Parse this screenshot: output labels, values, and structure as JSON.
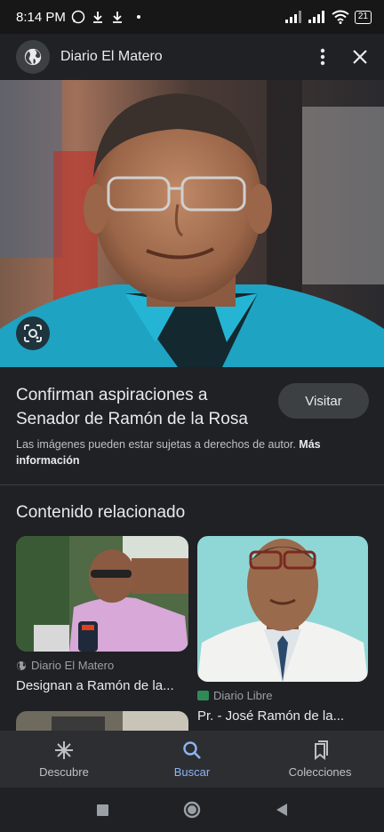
{
  "status_bar": {
    "time": "8:14 PM",
    "battery": "21"
  },
  "header": {
    "site_name": "Diario El Matero",
    "globe_icon": "globe-icon",
    "menu_icon": "more-vert-icon",
    "close_icon": "close-icon"
  },
  "result": {
    "title": "Confirman aspiraciones a Senador de Ramón de la Rosa",
    "visit_label": "Visitar",
    "copyright_text": "Las imágenes pueden estar sujetas a derechos de autor.",
    "more_info_label": "Más información"
  },
  "related": {
    "heading": "Contenido relacionado",
    "items": [
      {
        "source": "Diario El Matero",
        "caption": "Designan a Ramón de la..."
      },
      {
        "source": "Diario Libre",
        "caption": "Pr. - José Ramón de la..."
      }
    ]
  },
  "bottom_nav": {
    "items": [
      {
        "label": "Descubre",
        "icon": "asterisk-icon"
      },
      {
        "label": "Buscar",
        "icon": "search-icon"
      },
      {
        "label": "Colecciones",
        "icon": "collections-icon"
      }
    ]
  },
  "colors": {
    "accent": "#8ab4f8",
    "background": "#202124",
    "nav_background": "#2d2e31"
  }
}
